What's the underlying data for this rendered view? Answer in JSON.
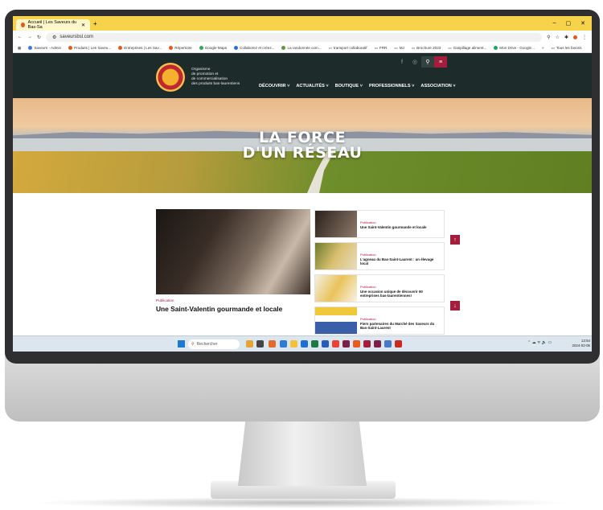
{
  "browser": {
    "tab_title": "Accueil | Les Saveurs du Bas-Sa",
    "new_tab": "+",
    "url": "saveursbsl.com",
    "window_controls": [
      "–",
      "▢",
      "✕"
    ],
    "bookmarks": [
      "Saveurs - Admin",
      "Produits | Les Saveu...",
      "Entreprises | Les Sav...",
      "Répertoire",
      "Google Maps",
      "Collaborez et créez...",
      "La randonnée com...",
      "transport collaboratif",
      "FRR",
      "MJ",
      "Brochure 2023",
      "Gaspillage aliment...",
      "Mon Drive - Google..."
    ],
    "bookmarks_more": "»",
    "all_bookmarks": "Tous les favoris"
  },
  "site": {
    "tagline": [
      "Organisme",
      "de promotion et",
      "de commercialisation",
      "des produits bas-laurentiens"
    ],
    "nav": [
      "DÉCOUVRIR ˅",
      "ACTUALITÉS ˅",
      "BOUTIQUE ˅",
      "PROFESSIONNELS ˅",
      "ASSOCIATION ˅"
    ],
    "hero_line1": "LA FORCE",
    "hero_line2": "D'UN RÉSEAU"
  },
  "featured": {
    "category": "Publication",
    "title": "Une Saint-Valentin gourmande et locale"
  },
  "cards": [
    {
      "category": "Publication",
      "title": "Une Saint-Valentin gourmande et locale"
    },
    {
      "category": "Publication",
      "title": "L'agneau du Bas-Saint-Laurent : un élevage local"
    },
    {
      "category": "Publication",
      "title": "Une occasion unique de découvrir 60 entreprises bas-laurentiennes!"
    },
    {
      "category": "Publication",
      "title": "Fiers partenaires du Marché des Saveurs du Bas-Saint-Laurent"
    }
  ],
  "taskbar": {
    "search_placeholder": "Rechercher",
    "time": "12:54",
    "date": "2024-02-05"
  },
  "colors": {
    "accent": "#a41d3c",
    "header_bg": "#1d2b2a",
    "tab_bar": "#f6d34a"
  }
}
